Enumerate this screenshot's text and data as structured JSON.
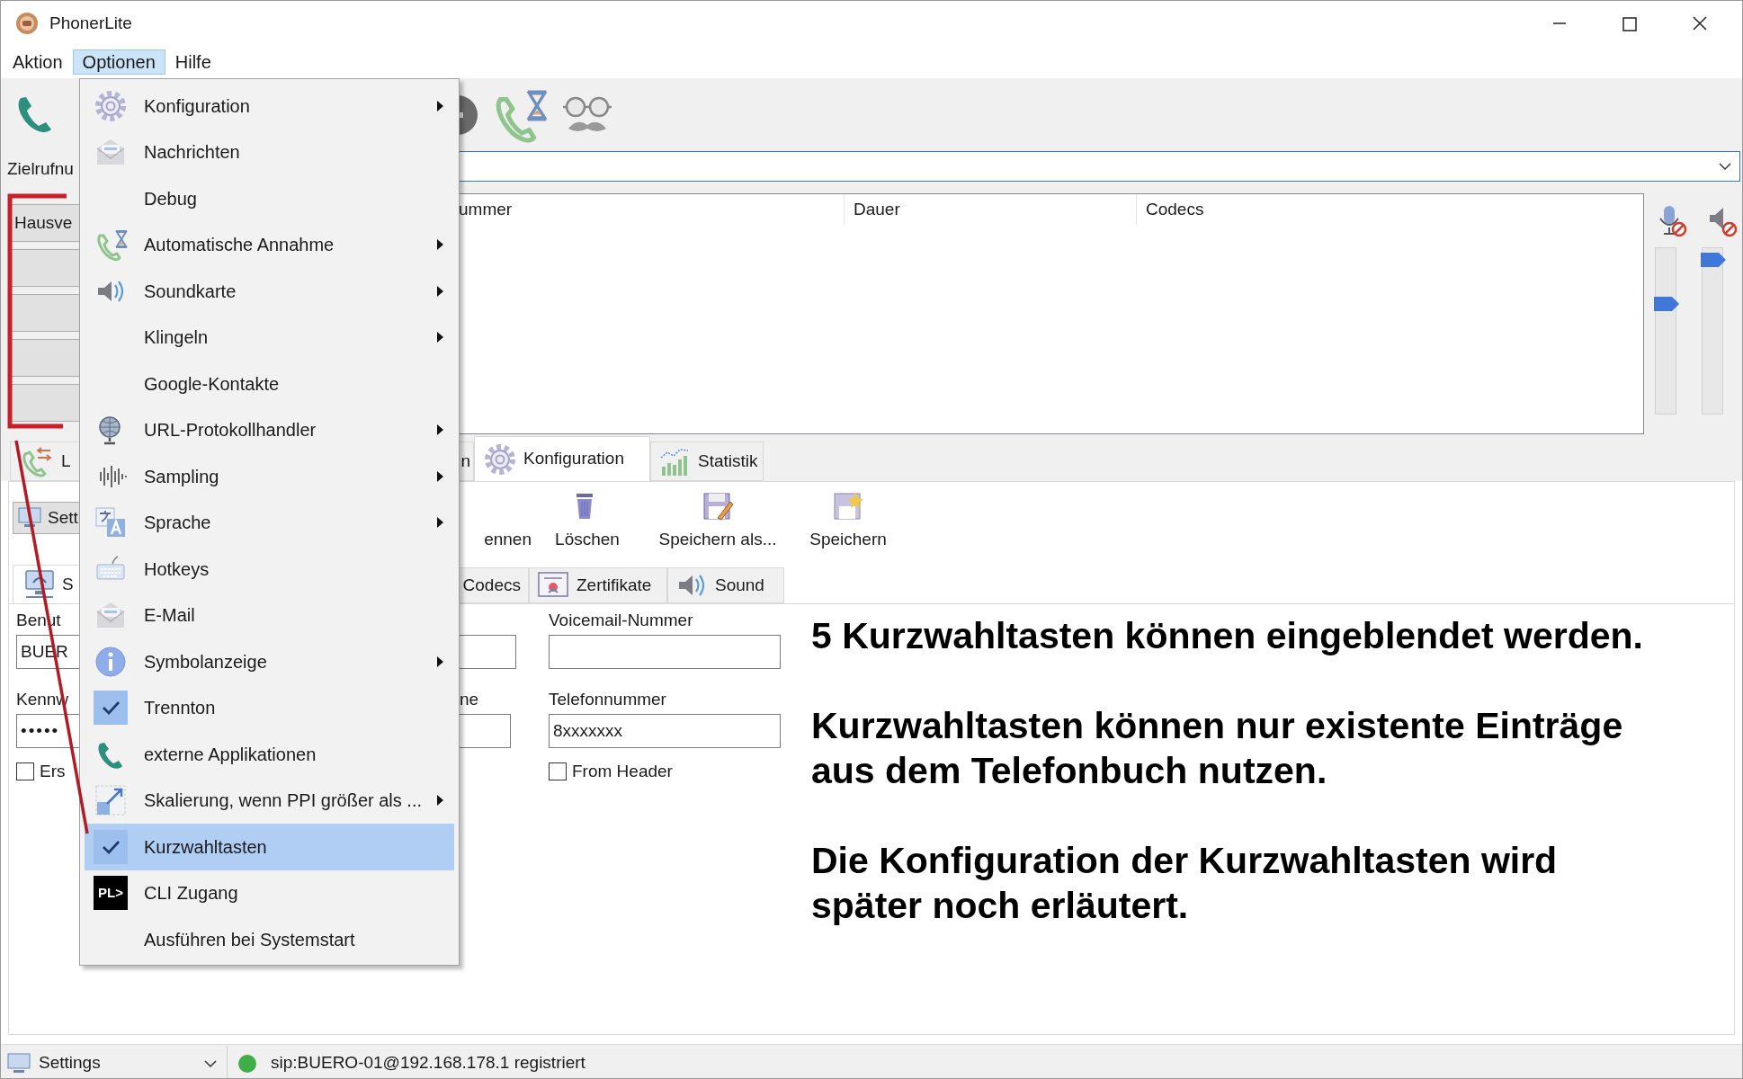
{
  "window": {
    "title": "PhonerLite"
  },
  "menu_bar": [
    {
      "label": "Aktion",
      "selected": false
    },
    {
      "label": "Optionen",
      "selected": true
    },
    {
      "label": "Hilfe",
      "selected": false
    }
  ],
  "destination": {
    "label": "Zielrufnu"
  },
  "speed_dial": [
    {
      "kind": "labeled",
      "label": "Hausve"
    },
    {
      "kind": "empty"
    },
    {
      "kind": "empty"
    },
    {
      "kind": "empty"
    },
    {
      "kind": "empty"
    }
  ],
  "calls_table": {
    "columns": [
      "ummer",
      "Dauer",
      "Codecs"
    ]
  },
  "volume": {
    "microphone": {
      "level": 0.67
    },
    "speaker": {
      "level": 0.96
    }
  },
  "tabs": [
    {
      "label": "L",
      "selected": false
    },
    {
      "label": "n",
      "selected": false
    },
    {
      "label": "Konfiguration",
      "selected": true
    },
    {
      "label": "Statistik",
      "selected": false
    }
  ],
  "profile_dropdown": {
    "value": "Sett"
  },
  "config_toolbar": [
    "ennen",
    "Löschen",
    "Speichern als...",
    "Speichern"
  ],
  "sub_tabs": [
    {
      "label": "S",
      "selected": true
    },
    {
      "label": "Codecs",
      "selected": false
    },
    {
      "label": "Zertifikate",
      "selected": false
    },
    {
      "label": "Sound",
      "selected": false
    }
  ],
  "form": {
    "username": {
      "label": "Benut",
      "value": "BUER"
    },
    "password": {
      "label": "Kennw",
      "value": "•••••"
    },
    "left_checkbox": {
      "label": "Ers",
      "checked": false
    },
    "middle_label": "ne",
    "voicemail": {
      "label": "Voicemail-Nummer"
    },
    "phone_number": {
      "label": "Telefonnummer",
      "value": "8xxxxxxx"
    },
    "from_header": {
      "label": "From Header",
      "checked": false
    }
  },
  "annotation": [
    "5 Kurzwahltasten können eingeblendet werden.",
    "Kurzwahltasten können nur existente Einträge aus dem Telefonbuch nutzen.",
    "Die Konfiguration der Kurzwahltasten wird später noch erläutert."
  ],
  "options_menu": [
    {
      "label": "Konfiguration",
      "checked": false,
      "submenu": true,
      "selected": false
    },
    {
      "label": "Nachrichten",
      "checked": false,
      "submenu": false,
      "selected": false
    },
    {
      "label": "Debug",
      "checked": false,
      "submenu": false,
      "selected": false
    },
    {
      "label": "Automatische Annahme",
      "checked": false,
      "submenu": true,
      "selected": false
    },
    {
      "label": "Soundkarte",
      "checked": false,
      "submenu": true,
      "selected": false
    },
    {
      "label": "Klingeln",
      "checked": false,
      "submenu": true,
      "selected": false
    },
    {
      "label": "Google-Kontakte",
      "checked": false,
      "submenu": false,
      "selected": false
    },
    {
      "label": "URL-Protokollhandler",
      "checked": false,
      "submenu": true,
      "selected": false
    },
    {
      "label": "Sampling",
      "checked": false,
      "submenu": true,
      "selected": false
    },
    {
      "label": "Sprache",
      "checked": false,
      "submenu": true,
      "selected": false
    },
    {
      "label": "Hotkeys",
      "checked": false,
      "submenu": false,
      "selected": false
    },
    {
      "label": "E-Mail",
      "checked": false,
      "submenu": false,
      "selected": false
    },
    {
      "label": "Symbolanzeige",
      "checked": false,
      "submenu": true,
      "selected": false
    },
    {
      "label": "Trennton",
      "checked": true,
      "submenu": false,
      "selected": false
    },
    {
      "label": "externe Applikationen",
      "checked": false,
      "submenu": false,
      "selected": false
    },
    {
      "label": "Skalierung, wenn PPI größer als ...",
      "checked": false,
      "submenu": true,
      "selected": false
    },
    {
      "label": "Kurzwahltasten",
      "checked": true,
      "submenu": false,
      "selected": true
    },
    {
      "label": "CLI Zugang",
      "checked": false,
      "submenu": false,
      "selected": false,
      "badge": "PL>"
    },
    {
      "label": "Ausführen bei Systemstart",
      "checked": false,
      "submenu": false,
      "selected": false
    }
  ],
  "status_bar": {
    "profile": "Settings",
    "registered": true,
    "registration": "sip:BUERO-01@192.168.178.1 registriert"
  }
}
